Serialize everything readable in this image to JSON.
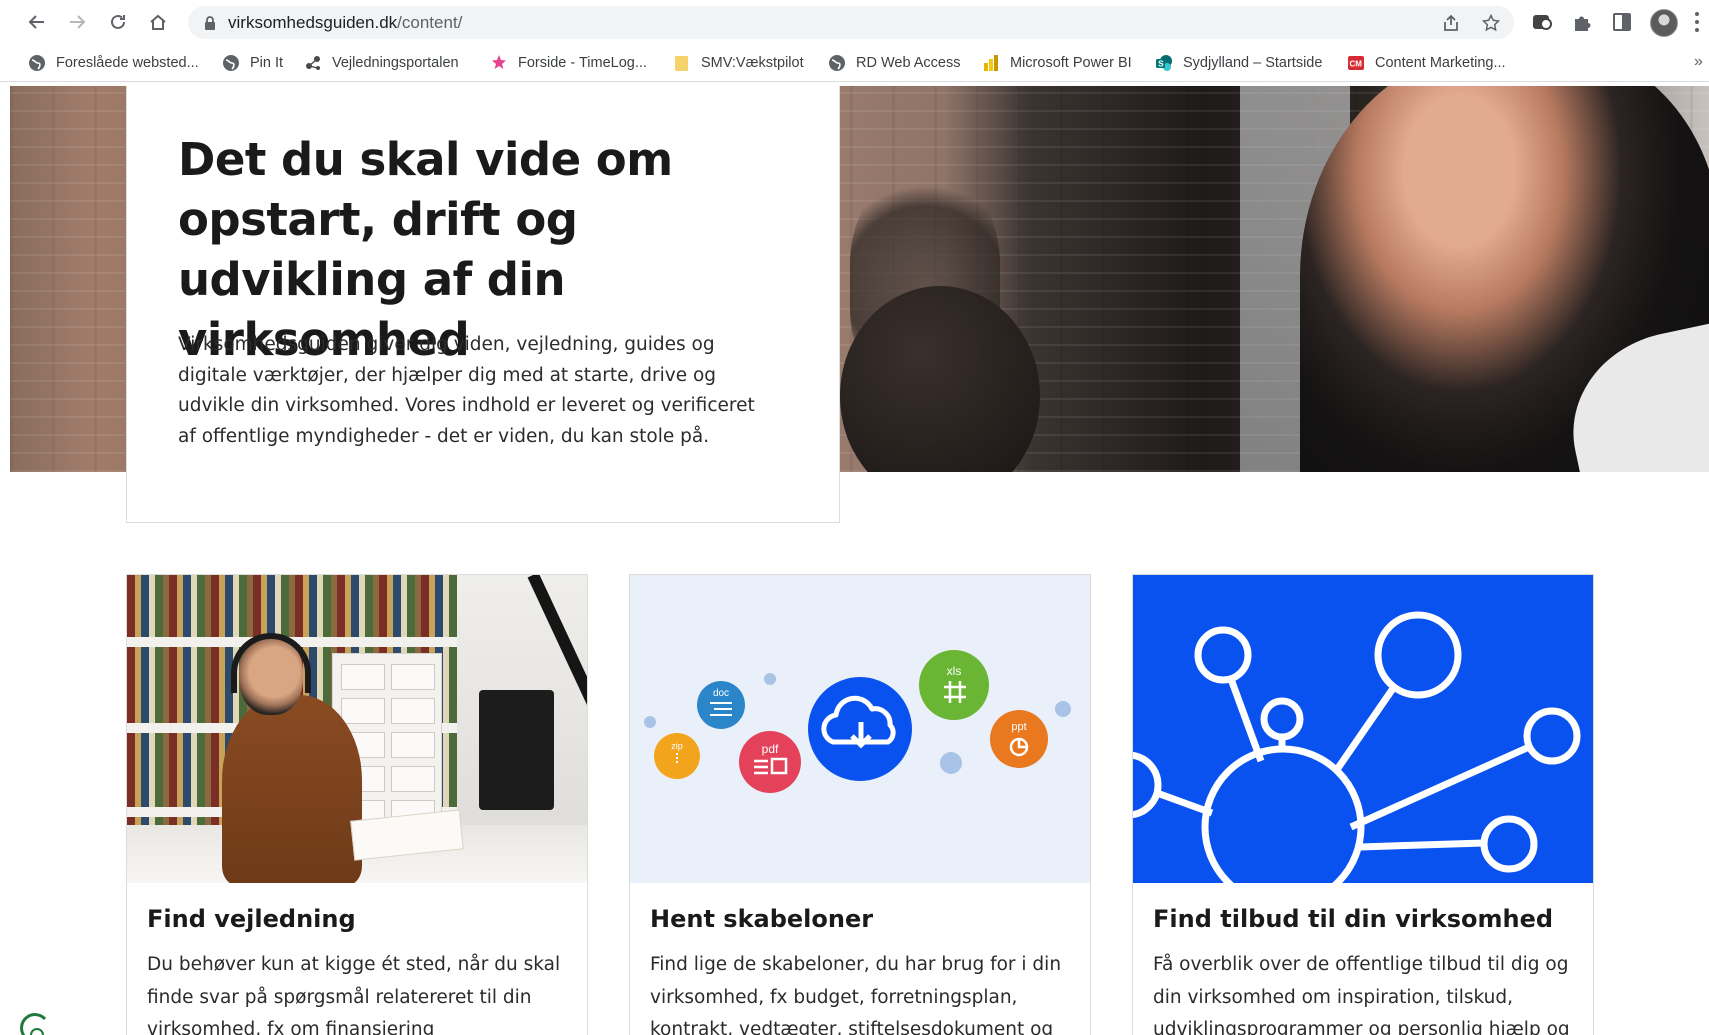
{
  "browser": {
    "url_host": "virksomhedsguiden.dk",
    "url_path": "/content/",
    "bookmarks": [
      {
        "label": "Foreslåede websted..."
      },
      {
        "label": "Pin It"
      },
      {
        "label": "Vejledningsportalen"
      },
      {
        "label": "Forside - TimeLog..."
      },
      {
        "label": "SMV:Vækstpilot"
      },
      {
        "label": "RD Web Access"
      },
      {
        "label": "Microsoft Power BI"
      },
      {
        "label": "Sydjylland – Startside"
      },
      {
        "label": "Content Marketing..."
      }
    ],
    "more_label": "»"
  },
  "hero": {
    "title": "Det du skal vide om opstart, drift og udvikling af din virksomhed",
    "text": "Virksomhedsguiden giver dig viden, vejledning, guides og digitale værktøjer, der hjælper dig med at starte, drive og udvikle din virksomhed. Vores indhold er leveret og verificeret af offentlige myndigheder - det er viden, du kan stole på."
  },
  "cards": [
    {
      "title": "Find vejledning",
      "text": "Du behøver kun at kigge ét sted, når du skal finde svar på spørgsmål relatereret til din virksomhed, fx om finansiering"
    },
    {
      "title": "Hent skabeloner",
      "text": "Find lige de skabeloner, du har brug for i din virksomhed, fx budget, forretningsplan, kontrakt, vedtægter, stiftelsesdokument og",
      "file_badges": [
        "doc",
        "xls",
        "zip",
        "pdf",
        "ppt"
      ]
    },
    {
      "title": "Find tilbud til din virksomhed",
      "text": "Få overblik over de offentlige tilbud til dig og din virksomhed om inspiration, tilskud, udviklingsprogrammer og personlig hjælp og"
    }
  ],
  "colors": {
    "card3_bg": "#0a52f0",
    "card2_bg": "#eaf0f9",
    "cloud_blue": "#0a52f0",
    "doc_blue": "#2a86c9",
    "xls_green": "#6ab533",
    "zip_yellow": "#f2a41c",
    "pdf_red": "#e4425a",
    "ppt_orange": "#e9781f"
  }
}
